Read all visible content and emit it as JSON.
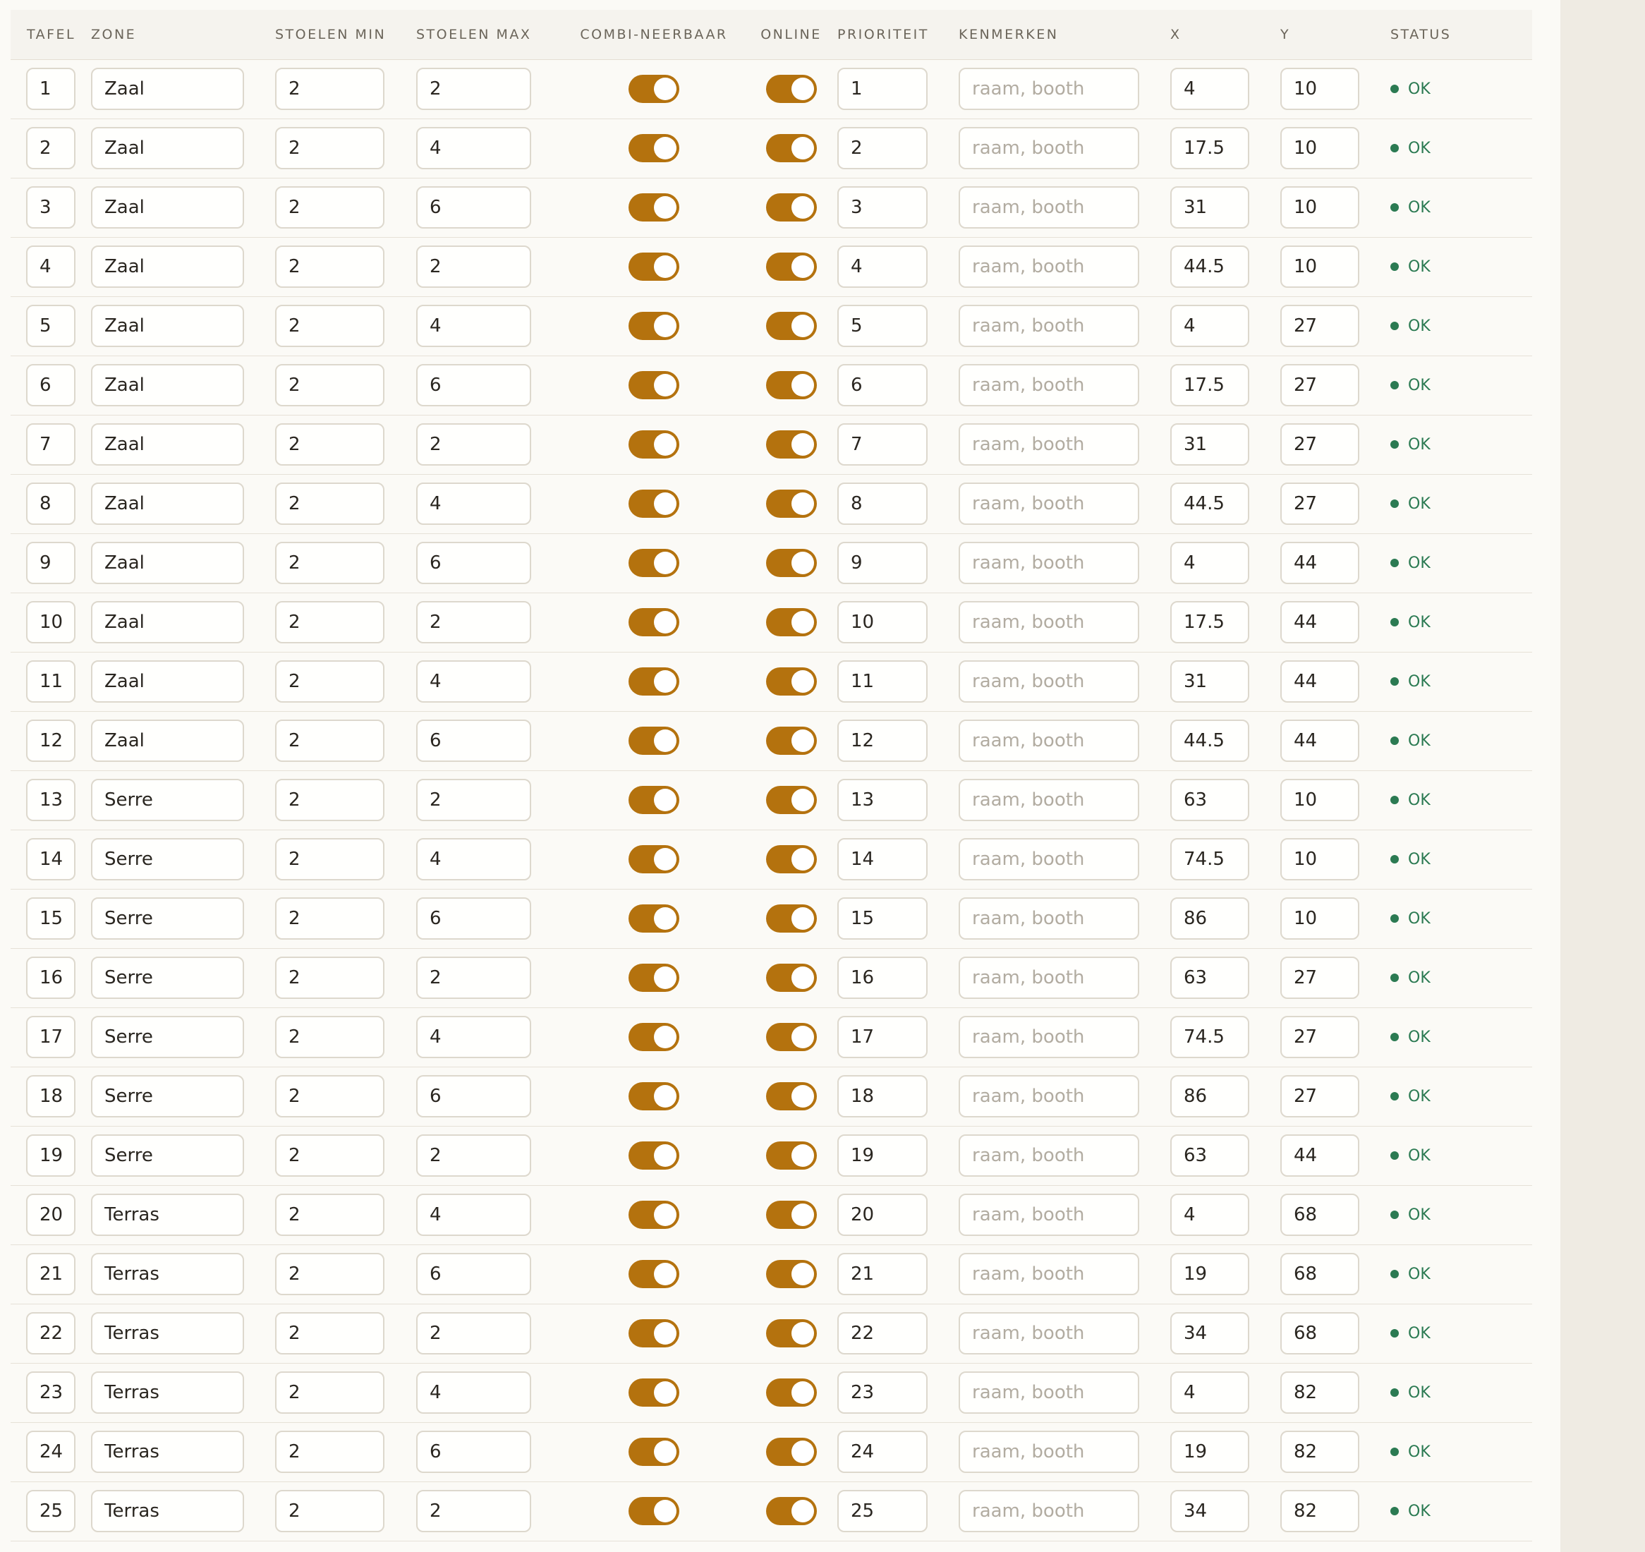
{
  "columns": {
    "tafel": "TAFEL",
    "zone": "ZONE",
    "stoelen_min": "STOELEN MIN",
    "stoelen_max": "STOELEN MAX",
    "combi": "COMBI-NEERBAAR",
    "online": "ONLINE",
    "prioriteit": "PRIORITEIT",
    "kenmerken": "KENMERKEN",
    "x": "X",
    "y": "Y",
    "status": "STATUS"
  },
  "kenmerken_placeholder": "raam, booth",
  "accent_color": "#b4720e",
  "status_color": "#2b7a52",
  "rows": [
    {
      "tafel": "1",
      "zone": "Zaal",
      "min": "2",
      "max": "2",
      "combi": true,
      "online": true,
      "prio": "1",
      "kenmerken": "",
      "x": "4",
      "y": "10",
      "status": "OK"
    },
    {
      "tafel": "2",
      "zone": "Zaal",
      "min": "2",
      "max": "4",
      "combi": true,
      "online": true,
      "prio": "2",
      "kenmerken": "",
      "x": "17.5",
      "y": "10",
      "status": "OK"
    },
    {
      "tafel": "3",
      "zone": "Zaal",
      "min": "2",
      "max": "6",
      "combi": true,
      "online": true,
      "prio": "3",
      "kenmerken": "",
      "x": "31",
      "y": "10",
      "status": "OK"
    },
    {
      "tafel": "4",
      "zone": "Zaal",
      "min": "2",
      "max": "2",
      "combi": true,
      "online": true,
      "prio": "4",
      "kenmerken": "",
      "x": "44.5",
      "y": "10",
      "status": "OK"
    },
    {
      "tafel": "5",
      "zone": "Zaal",
      "min": "2",
      "max": "4",
      "combi": true,
      "online": true,
      "prio": "5",
      "kenmerken": "",
      "x": "4",
      "y": "27",
      "status": "OK"
    },
    {
      "tafel": "6",
      "zone": "Zaal",
      "min": "2",
      "max": "6",
      "combi": true,
      "online": true,
      "prio": "6",
      "kenmerken": "",
      "x": "17.5",
      "y": "27",
      "status": "OK"
    },
    {
      "tafel": "7",
      "zone": "Zaal",
      "min": "2",
      "max": "2",
      "combi": true,
      "online": true,
      "prio": "7",
      "kenmerken": "",
      "x": "31",
      "y": "27",
      "status": "OK"
    },
    {
      "tafel": "8",
      "zone": "Zaal",
      "min": "2",
      "max": "4",
      "combi": true,
      "online": true,
      "prio": "8",
      "kenmerken": "",
      "x": "44.5",
      "y": "27",
      "status": "OK"
    },
    {
      "tafel": "9",
      "zone": "Zaal",
      "min": "2",
      "max": "6",
      "combi": true,
      "online": true,
      "prio": "9",
      "kenmerken": "",
      "x": "4",
      "y": "44",
      "status": "OK"
    },
    {
      "tafel": "10",
      "zone": "Zaal",
      "min": "2",
      "max": "2",
      "combi": true,
      "online": true,
      "prio": "10",
      "kenmerken": "",
      "x": "17.5",
      "y": "44",
      "status": "OK"
    },
    {
      "tafel": "11",
      "zone": "Zaal",
      "min": "2",
      "max": "4",
      "combi": true,
      "online": true,
      "prio": "11",
      "kenmerken": "",
      "x": "31",
      "y": "44",
      "status": "OK"
    },
    {
      "tafel": "12",
      "zone": "Zaal",
      "min": "2",
      "max": "6",
      "combi": true,
      "online": true,
      "prio": "12",
      "kenmerken": "",
      "x": "44.5",
      "y": "44",
      "status": "OK"
    },
    {
      "tafel": "13",
      "zone": "Serre",
      "min": "2",
      "max": "2",
      "combi": true,
      "online": true,
      "prio": "13",
      "kenmerken": "",
      "x": "63",
      "y": "10",
      "status": "OK"
    },
    {
      "tafel": "14",
      "zone": "Serre",
      "min": "2",
      "max": "4",
      "combi": true,
      "online": true,
      "prio": "14",
      "kenmerken": "",
      "x": "74.5",
      "y": "10",
      "status": "OK"
    },
    {
      "tafel": "15",
      "zone": "Serre",
      "min": "2",
      "max": "6",
      "combi": true,
      "online": true,
      "prio": "15",
      "kenmerken": "",
      "x": "86",
      "y": "10",
      "status": "OK"
    },
    {
      "tafel": "16",
      "zone": "Serre",
      "min": "2",
      "max": "2",
      "combi": true,
      "online": true,
      "prio": "16",
      "kenmerken": "",
      "x": "63",
      "y": "27",
      "status": "OK"
    },
    {
      "tafel": "17",
      "zone": "Serre",
      "min": "2",
      "max": "4",
      "combi": true,
      "online": true,
      "prio": "17",
      "kenmerken": "",
      "x": "74.5",
      "y": "27",
      "status": "OK"
    },
    {
      "tafel": "18",
      "zone": "Serre",
      "min": "2",
      "max": "6",
      "combi": true,
      "online": true,
      "prio": "18",
      "kenmerken": "",
      "x": "86",
      "y": "27",
      "status": "OK"
    },
    {
      "tafel": "19",
      "zone": "Serre",
      "min": "2",
      "max": "2",
      "combi": true,
      "online": true,
      "prio": "19",
      "kenmerken": "",
      "x": "63",
      "y": "44",
      "status": "OK"
    },
    {
      "tafel": "20",
      "zone": "Terras",
      "min": "2",
      "max": "4",
      "combi": true,
      "online": true,
      "prio": "20",
      "kenmerken": "",
      "x": "4",
      "y": "68",
      "status": "OK"
    },
    {
      "tafel": "21",
      "zone": "Terras",
      "min": "2",
      "max": "6",
      "combi": true,
      "online": true,
      "prio": "21",
      "kenmerken": "",
      "x": "19",
      "y": "68",
      "status": "OK"
    },
    {
      "tafel": "22",
      "zone": "Terras",
      "min": "2",
      "max": "2",
      "combi": true,
      "online": true,
      "prio": "22",
      "kenmerken": "",
      "x": "34",
      "y": "68",
      "status": "OK"
    },
    {
      "tafel": "23",
      "zone": "Terras",
      "min": "2",
      "max": "4",
      "combi": true,
      "online": true,
      "prio": "23",
      "kenmerken": "",
      "x": "4",
      "y": "82",
      "status": "OK"
    },
    {
      "tafel": "24",
      "zone": "Terras",
      "min": "2",
      "max": "6",
      "combi": true,
      "online": true,
      "prio": "24",
      "kenmerken": "",
      "x": "19",
      "y": "82",
      "status": "OK"
    },
    {
      "tafel": "25",
      "zone": "Terras",
      "min": "2",
      "max": "2",
      "combi": true,
      "online": true,
      "prio": "25",
      "kenmerken": "",
      "x": "34",
      "y": "82",
      "status": "OK"
    }
  ]
}
